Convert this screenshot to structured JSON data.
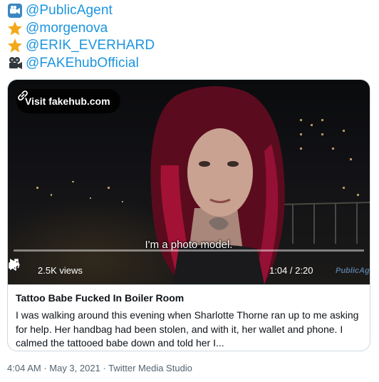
{
  "mentions": [
    {
      "icon": "movie-camera-emoji-icon",
      "handle": "@PublicAgent"
    },
    {
      "icon": "star-emoji-icon",
      "handle": "@morgenova"
    },
    {
      "icon": "star-emoji-icon",
      "handle": "@ERIK_EVERHARD"
    },
    {
      "icon": "film-camera-emoji-icon",
      "handle": "@FAKEhubOfficial"
    }
  ],
  "card": {
    "visit_label": "Visit fakehub.com",
    "subtitle": "I'm a photo model.",
    "views": "2.5K views",
    "time": "1:04 / 2:20",
    "watermark": "PublicAgent.com",
    "title": "Tattoo Babe Fucked In Boiler Room",
    "description": "I was walking around this evening when Sharlotte Thorne ran up to me asking for help. Her handbag had been stolen, and with it, her wallet and phone. I calmed the tattooed babe down and told her I..."
  },
  "meta": {
    "time": "4:04 AM",
    "separator1": " · ",
    "date": "May 3, 2021",
    "separator2": " · ",
    "source": "Twitter Media Studio"
  },
  "colors": {
    "link": "#1b95e0",
    "star": "#f4a91a",
    "meta": "#536471"
  }
}
